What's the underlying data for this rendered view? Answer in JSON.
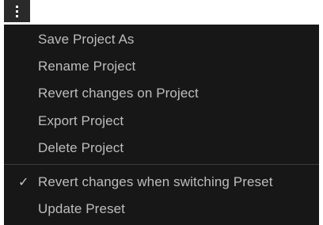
{
  "menu": {
    "items": [
      {
        "label": "Save Project As"
      },
      {
        "label": "Rename Project"
      },
      {
        "label": "Revert changes on Project"
      },
      {
        "label": "Export Project"
      },
      {
        "label": "Delete Project"
      }
    ],
    "options": [
      {
        "label": "Revert changes when switching Preset",
        "checked": true,
        "check_glyph": "✓"
      },
      {
        "label": "Update Preset",
        "checked": false
      }
    ]
  },
  "icons": {
    "menu_button": "kebab-vertical-icon",
    "check": "checkmark-icon"
  },
  "colors": {
    "menu_background": "#171717",
    "button_background": "#2a2a2a",
    "text": "#bdbdbd",
    "divider": "#3c3c3c"
  }
}
